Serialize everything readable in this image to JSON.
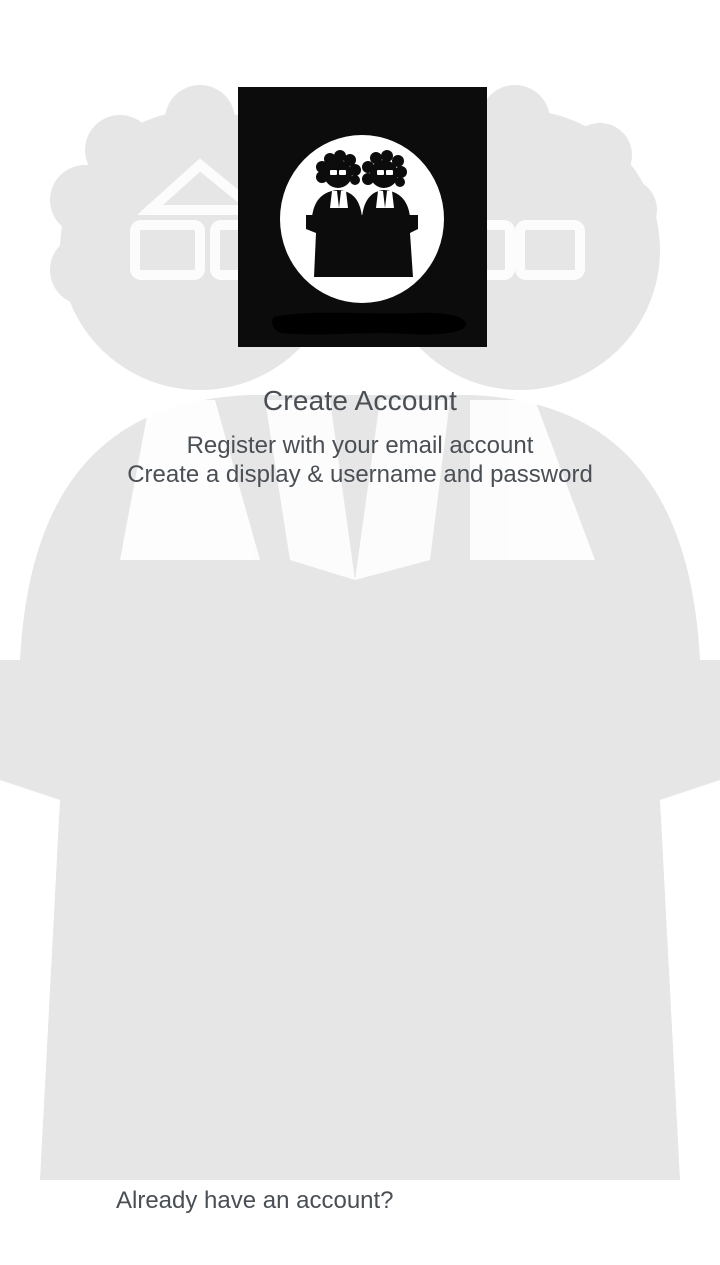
{
  "colors": {
    "background": "#ffffff",
    "watermark": "#e6e6e6",
    "logo_background": "#0c0c0d",
    "text": "#4a4f55"
  },
  "logo": {
    "icon": "two-judges-icon"
  },
  "header": {
    "title": "Create Account",
    "subtitle_line1": "Register with your email account",
    "subtitle_line2": "Create a display & username and password"
  },
  "footer": {
    "login_prompt": "Already have an account?"
  }
}
